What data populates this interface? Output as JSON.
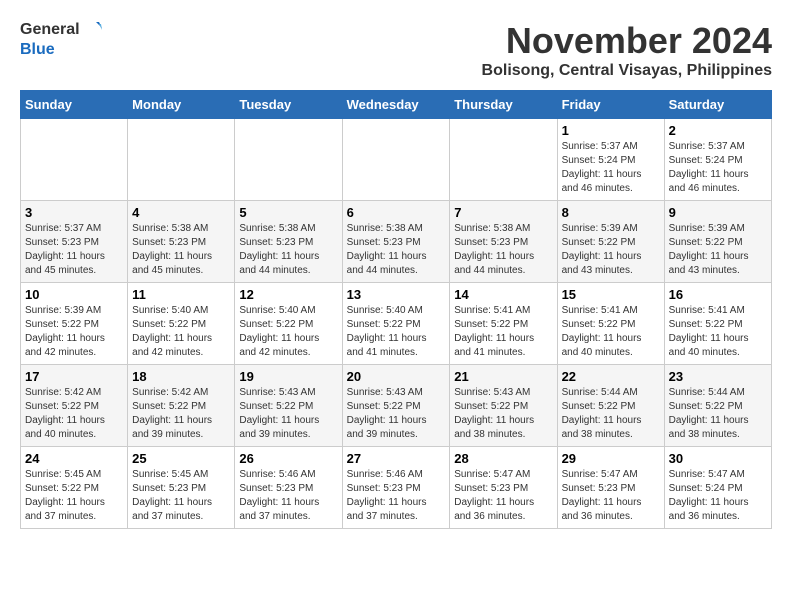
{
  "header": {
    "logo_general": "General",
    "logo_blue": "Blue",
    "month_title": "November 2024",
    "location": "Bolisong, Central Visayas, Philippines"
  },
  "days_of_week": [
    "Sunday",
    "Monday",
    "Tuesday",
    "Wednesday",
    "Thursday",
    "Friday",
    "Saturday"
  ],
  "weeks": [
    [
      {
        "day": "",
        "info": ""
      },
      {
        "day": "",
        "info": ""
      },
      {
        "day": "",
        "info": ""
      },
      {
        "day": "",
        "info": ""
      },
      {
        "day": "",
        "info": ""
      },
      {
        "day": "1",
        "info": "Sunrise: 5:37 AM\nSunset: 5:24 PM\nDaylight: 11 hours and 46 minutes."
      },
      {
        "day": "2",
        "info": "Sunrise: 5:37 AM\nSunset: 5:24 PM\nDaylight: 11 hours and 46 minutes."
      }
    ],
    [
      {
        "day": "3",
        "info": "Sunrise: 5:37 AM\nSunset: 5:23 PM\nDaylight: 11 hours and 45 minutes."
      },
      {
        "day": "4",
        "info": "Sunrise: 5:38 AM\nSunset: 5:23 PM\nDaylight: 11 hours and 45 minutes."
      },
      {
        "day": "5",
        "info": "Sunrise: 5:38 AM\nSunset: 5:23 PM\nDaylight: 11 hours and 44 minutes."
      },
      {
        "day": "6",
        "info": "Sunrise: 5:38 AM\nSunset: 5:23 PM\nDaylight: 11 hours and 44 minutes."
      },
      {
        "day": "7",
        "info": "Sunrise: 5:38 AM\nSunset: 5:23 PM\nDaylight: 11 hours and 44 minutes."
      },
      {
        "day": "8",
        "info": "Sunrise: 5:39 AM\nSunset: 5:22 PM\nDaylight: 11 hours and 43 minutes."
      },
      {
        "day": "9",
        "info": "Sunrise: 5:39 AM\nSunset: 5:22 PM\nDaylight: 11 hours and 43 minutes."
      }
    ],
    [
      {
        "day": "10",
        "info": "Sunrise: 5:39 AM\nSunset: 5:22 PM\nDaylight: 11 hours and 42 minutes."
      },
      {
        "day": "11",
        "info": "Sunrise: 5:40 AM\nSunset: 5:22 PM\nDaylight: 11 hours and 42 minutes."
      },
      {
        "day": "12",
        "info": "Sunrise: 5:40 AM\nSunset: 5:22 PM\nDaylight: 11 hours and 42 minutes."
      },
      {
        "day": "13",
        "info": "Sunrise: 5:40 AM\nSunset: 5:22 PM\nDaylight: 11 hours and 41 minutes."
      },
      {
        "day": "14",
        "info": "Sunrise: 5:41 AM\nSunset: 5:22 PM\nDaylight: 11 hours and 41 minutes."
      },
      {
        "day": "15",
        "info": "Sunrise: 5:41 AM\nSunset: 5:22 PM\nDaylight: 11 hours and 40 minutes."
      },
      {
        "day": "16",
        "info": "Sunrise: 5:41 AM\nSunset: 5:22 PM\nDaylight: 11 hours and 40 minutes."
      }
    ],
    [
      {
        "day": "17",
        "info": "Sunrise: 5:42 AM\nSunset: 5:22 PM\nDaylight: 11 hours and 40 minutes."
      },
      {
        "day": "18",
        "info": "Sunrise: 5:42 AM\nSunset: 5:22 PM\nDaylight: 11 hours and 39 minutes."
      },
      {
        "day": "19",
        "info": "Sunrise: 5:43 AM\nSunset: 5:22 PM\nDaylight: 11 hours and 39 minutes."
      },
      {
        "day": "20",
        "info": "Sunrise: 5:43 AM\nSunset: 5:22 PM\nDaylight: 11 hours and 39 minutes."
      },
      {
        "day": "21",
        "info": "Sunrise: 5:43 AM\nSunset: 5:22 PM\nDaylight: 11 hours and 38 minutes."
      },
      {
        "day": "22",
        "info": "Sunrise: 5:44 AM\nSunset: 5:22 PM\nDaylight: 11 hours and 38 minutes."
      },
      {
        "day": "23",
        "info": "Sunrise: 5:44 AM\nSunset: 5:22 PM\nDaylight: 11 hours and 38 minutes."
      }
    ],
    [
      {
        "day": "24",
        "info": "Sunrise: 5:45 AM\nSunset: 5:22 PM\nDaylight: 11 hours and 37 minutes."
      },
      {
        "day": "25",
        "info": "Sunrise: 5:45 AM\nSunset: 5:23 PM\nDaylight: 11 hours and 37 minutes."
      },
      {
        "day": "26",
        "info": "Sunrise: 5:46 AM\nSunset: 5:23 PM\nDaylight: 11 hours and 37 minutes."
      },
      {
        "day": "27",
        "info": "Sunrise: 5:46 AM\nSunset: 5:23 PM\nDaylight: 11 hours and 37 minutes."
      },
      {
        "day": "28",
        "info": "Sunrise: 5:47 AM\nSunset: 5:23 PM\nDaylight: 11 hours and 36 minutes."
      },
      {
        "day": "29",
        "info": "Sunrise: 5:47 AM\nSunset: 5:23 PM\nDaylight: 11 hours and 36 minutes."
      },
      {
        "day": "30",
        "info": "Sunrise: 5:47 AM\nSunset: 5:24 PM\nDaylight: 11 hours and 36 minutes."
      }
    ]
  ]
}
